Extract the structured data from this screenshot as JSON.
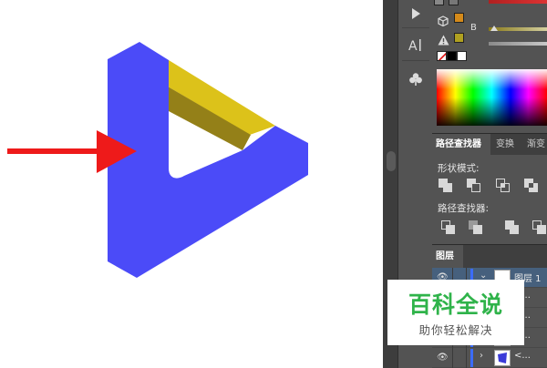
{
  "colors": {
    "triangle_blue": "#4b4bf8",
    "triangle_yellow": "#dcc21a",
    "triangle_olive": "#948018",
    "arrow_red": "#ee1a1a",
    "panel_bg": "#535353",
    "selected_layer": "#46607d",
    "watermark_green": "#2fb34a"
  },
  "tool_strip": {
    "icons": [
      "play-icon",
      "character-type-icon",
      "warning-icon",
      "club-symbol-icon"
    ]
  },
  "color_panel": {
    "channel_b_label": "B"
  },
  "pathfinder": {
    "tabs": [
      "路径查找器",
      "变换",
      "渐变"
    ],
    "shape_modes_label": "形状模式:",
    "pathfinders_label": "路径查找器:"
  },
  "layers": {
    "tab_label": "图层",
    "rows": [
      {
        "name": "图层 1"
      },
      {
        "name": "<..."
      },
      {
        "name": "<..."
      },
      {
        "name": "<..."
      },
      {
        "name": "<..."
      }
    ]
  },
  "watermark": {
    "title": "百科全说",
    "subtitle": "助你轻松解决"
  }
}
